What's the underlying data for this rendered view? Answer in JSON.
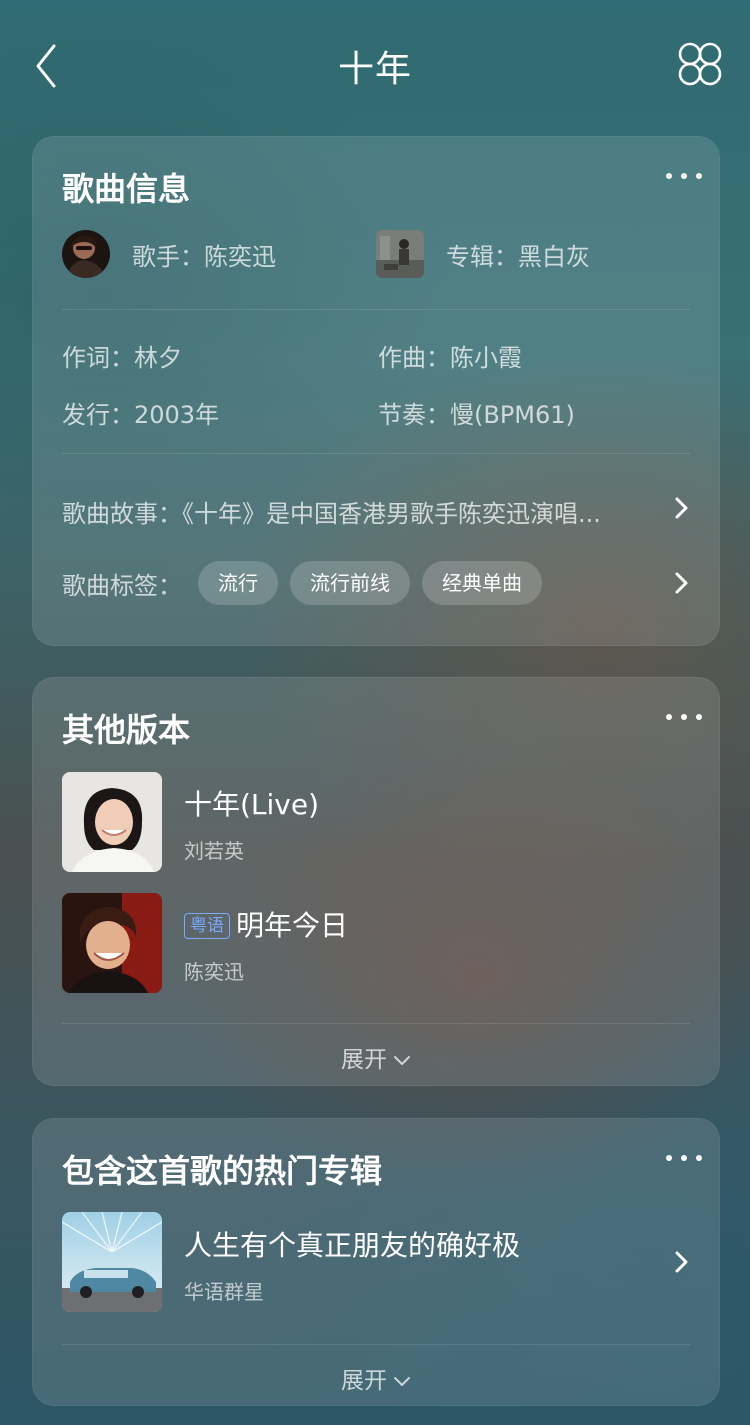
{
  "header": {
    "title": "十年"
  },
  "song_info": {
    "title": "歌曲信息",
    "singer_label": "歌手：陈奕迅",
    "album_label": "专辑：黑白灰",
    "lyricist": "作词：林夕",
    "composer": "作曲：陈小霞",
    "release": "发行：2003年",
    "tempo": "节奏：慢(BPM61)",
    "story": "歌曲故事：《十年》是中国香港男歌手陈奕迅演唱...",
    "tags_label": "歌曲标签：",
    "tags": [
      "流行",
      "流行前线",
      "经典单曲"
    ]
  },
  "other_versions": {
    "title": "其他版本",
    "items": [
      {
        "title": "十年(Live)",
        "artist": "刘若英",
        "badge": ""
      },
      {
        "title": "明年今日",
        "artist": "陈奕迅",
        "badge": "粤语"
      }
    ],
    "expand_label": "展开"
  },
  "albums": {
    "title": "包含这首歌的热门专辑",
    "items": [
      {
        "title": "人生有个真正朋友的确好极",
        "artist": "华语群星"
      }
    ],
    "expand_label": "展开"
  }
}
